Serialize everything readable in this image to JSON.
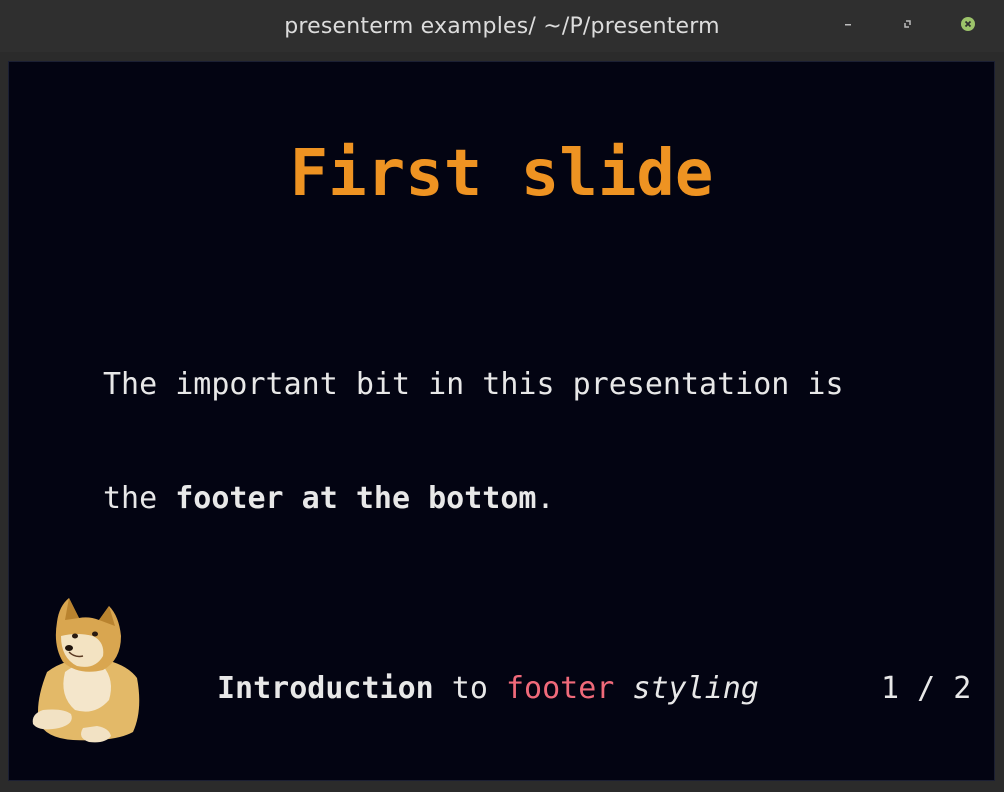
{
  "window": {
    "title": "presenterm examples/ ~/P/presenterm",
    "controls": {
      "minimize_icon": "minimize-icon",
      "maximize_icon": "maximize-icon",
      "close_icon": "close-icon",
      "close_color": "#9cc36a"
    }
  },
  "slide": {
    "title": "First slide",
    "title_color": "#ee9322",
    "body": {
      "line1": "The important bit in this presentation is",
      "line2_prefix": "the ",
      "line2_bold": "footer at the bottom",
      "line2_suffix": "."
    }
  },
  "footer": {
    "logo": "doge-image",
    "bold": "Introduction",
    "plain": " to ",
    "red": "footer",
    "space": " ",
    "italic": "styling",
    "accent_color": "#f06a7a",
    "page": "1 / 2"
  }
}
